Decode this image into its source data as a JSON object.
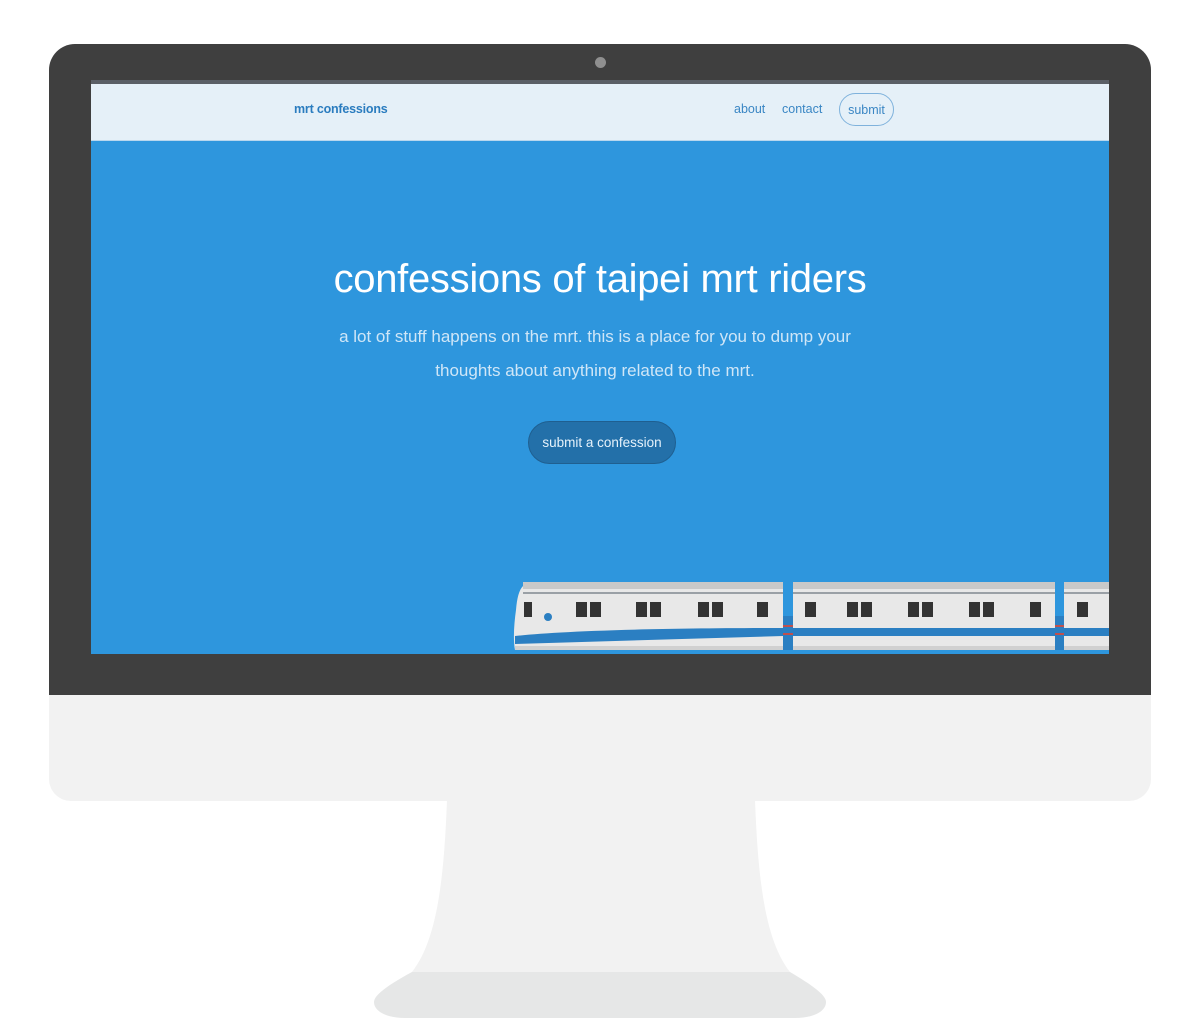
{
  "nav": {
    "brand": "mrt confessions",
    "about": "about",
    "contact": "contact",
    "submit": "submit"
  },
  "hero": {
    "title": "confessions of taipei mrt riders",
    "subtitle": "a lot of stuff happens on the mrt. this is a place for you to dump your thoughts about anything related to the mrt.",
    "cta": "submit a confession"
  },
  "colors": {
    "hero_bg": "#2e96dd",
    "navbar_bg": "#e5f0f8",
    "cta_bg": "#2370a9",
    "bezel": "#3f3f3f",
    "chin": "#f2f2f2"
  },
  "icons": {
    "illustration": "train-illustration",
    "camera": "camera-icon"
  }
}
